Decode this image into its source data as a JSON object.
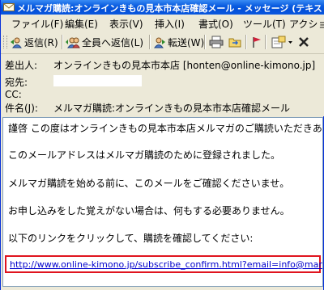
{
  "window": {
    "title": "メルマガ購読:オンラインきもの見本市本店確認メール - メッセージ (テキスト形式)"
  },
  "menu": [
    "ファイル(F)",
    "編集(E)",
    "表示(V)",
    "挿入(I)",
    "書式(O)",
    "ツール(T)",
    "アクション"
  ],
  "toolbar": {
    "reply_label": "返信(R)",
    "reply_all_label": "全員へ返信(L)",
    "forward_label": "転送(W)"
  },
  "headers": {
    "from_label": "差出人:",
    "from_value": "オンラインきもの見本市本店 [honten@online-kimono.jp]",
    "to_label": "宛先:",
    "cc_label": "CC:",
    "subject_label": "件名(J):",
    "subject_value": "メルマガ購読:オンラインきもの見本市本店確認メール"
  },
  "body": {
    "line1": "謹啓 この度はオンラインきもの見本市本店メルマガのご購読いただきあ",
    "line2": "このメールアドレスはメルマガ購読のために登録されました。",
    "line3": "メルマガ購読を始める前に、このメールをご確認くださいませ。",
    "line4": "お申し込みをした覚えがない場合は、何もする必要ありません。",
    "line5": "以下のリンクをクリックして、購読を確認してください:",
    "link": "http://www.online-kimono.jp/subscribe_confirm.html?email=info@mar"
  },
  "colors": {
    "titlebar": "#0a5ce0",
    "highlight_border": "#e0141e",
    "link": "#0000cc"
  }
}
